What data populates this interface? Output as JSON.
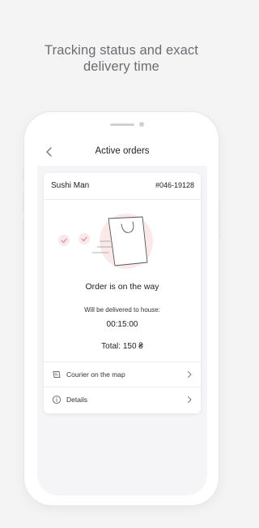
{
  "headline": {
    "line1": "Tracking status and exact",
    "line2": "delivery time"
  },
  "topbar": {
    "title": "Active orders",
    "back_icon": "chevron-left-icon"
  },
  "order": {
    "store_name": "Sushi Man",
    "order_number": "#046-19128",
    "status": "Order is on the way",
    "delivery_label": "Will be delivered to house:",
    "delivery_time": "00:15:00",
    "total": "Total: 150 ₴"
  },
  "actions": [
    {
      "label": "Courier on the map",
      "icon": "map-icon"
    },
    {
      "label": "Details",
      "icon": "info-icon"
    }
  ],
  "colors": {
    "accent": "#d98a8a",
    "accent_light": "#fbe9ea",
    "background": "#f4f4f5"
  }
}
